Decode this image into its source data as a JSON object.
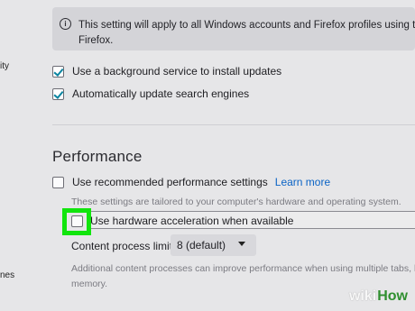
{
  "sidebar": {
    "item_one": "ity",
    "item_two": "nes"
  },
  "info": {
    "icon": "info-icon",
    "line1": "This setting will apply to all Windows accounts and Firefox profiles using this i",
    "line2": "Firefox."
  },
  "updates": {
    "background_service_label": "Use a background service to install updates",
    "search_engines_label": "Automatically update search engines"
  },
  "performance": {
    "title": "Performance",
    "recommended_label": "Use recommended performance settings",
    "learn_more": "Learn more",
    "recommended_help": "These settings are tailored to your computer's hardware and operating system.",
    "hardware_acceleration_label": "Use hardware acceleration when available",
    "content_process_label": "Content process limit",
    "content_process_value": "8 (default)",
    "content_process_help_line1": "Additional content processes can improve performance when using multiple tabs, but",
    "content_process_help_line2": "memory."
  },
  "watermark": {
    "wiki": "wiki",
    "how": "How"
  },
  "colors": {
    "background": "#e6e6e8",
    "info_box": "#d4d4d8",
    "accent_link": "#0a63c5",
    "checkbox_check": "#0a84a0",
    "highlight_green": "#11e50d",
    "watermark_green": "#2f8f2f"
  }
}
